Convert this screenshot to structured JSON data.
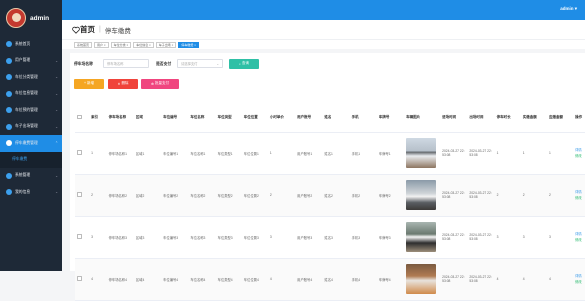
{
  "topbar": {
    "user": "admin ▾"
  },
  "brand": {
    "name": "admin"
  },
  "sidebar": {
    "items": [
      {
        "label": "系统首页",
        "arrow": ""
      },
      {
        "label": "用户管理",
        "arrow": "⌄"
      },
      {
        "label": "车位分类管理",
        "arrow": "⌄"
      },
      {
        "label": "车位信息管理",
        "arrow": "⌄"
      },
      {
        "label": "车位预约管理",
        "arrow": "⌄"
      },
      {
        "label": "车子出场管理",
        "arrow": "⌄"
      },
      {
        "label": "停车缴费管理",
        "arrow": "⌃"
      }
    ],
    "sub_item": "停车缴费",
    "items2": [
      {
        "label": "系统管理",
        "arrow": "⌄"
      },
      {
        "label": "我的信息",
        "arrow": "⌄"
      }
    ]
  },
  "header": {
    "home": "首页",
    "page": "停车缴费"
  },
  "tabs": [
    "系统首页",
    "用户 ×",
    "车位分类 ×",
    "车位信息 ×",
    "车子出场 ×",
    "停车缴费 ×"
  ],
  "filters": {
    "name_label": "停车场名称",
    "name_placeholder": "停车场名称",
    "paid_label": "是否支付",
    "paid_placeholder": "请选择支付",
    "search": "查询"
  },
  "actions": {
    "add": "+ 新增",
    "delete": "删除",
    "batch": "批量支付"
  },
  "table": {
    "headers": [
      "索引",
      "停车场名称",
      "区域",
      "车位编号",
      "车位名称",
      "车位类型",
      "车位位置",
      "小时单价",
      "用户账号",
      "姓名",
      "手机",
      "车牌号",
      "车辆图片",
      "进场时间",
      "出场时间",
      "停车时长",
      "实缴金额",
      "应缴金额",
      "操作"
    ],
    "rows": [
      {
        "idx": "1",
        "lot": "停车场名称1",
        "area": "区域1",
        "no": "车位编号1",
        "name": "车位名称1",
        "type": "车位类型1",
        "loc": "车位位置1",
        "price": "1",
        "acct": "用户账号1",
        "person": "姓名1",
        "phone": "手机1",
        "plate": "车牌号1",
        "in": "2024-03-27 22:53:08",
        "out": "2024-03-27 22:53:08",
        "dur": "1",
        "paid": "1",
        "due": "1",
        "op1": "详情",
        "op2": "修改"
      },
      {
        "idx": "2",
        "lot": "停车场名称2",
        "area": "区域2",
        "no": "车位编号2",
        "name": "车位名称2",
        "type": "车位类型2",
        "loc": "车位位置2",
        "price": "2",
        "acct": "用户账号2",
        "person": "姓名2",
        "phone": "手机2",
        "plate": "车牌号2",
        "in": "2024-03-27 22:53:08",
        "out": "2024-03-27 22:53:08",
        "dur": "2",
        "paid": "2",
        "due": "2",
        "op1": "详情",
        "op2": "修改"
      },
      {
        "idx": "3",
        "lot": "停车场名称3",
        "area": "区域3",
        "no": "车位编号3",
        "name": "车位名称3",
        "type": "车位类型3",
        "loc": "车位位置3",
        "price": "3",
        "acct": "用户账号3",
        "person": "姓名3",
        "phone": "手机3",
        "plate": "车牌号3",
        "in": "2024-03-27 22:53:08",
        "out": "2024-03-27 22:53:08",
        "dur": "3",
        "paid": "3",
        "due": "3",
        "op1": "详情",
        "op2": "修改"
      },
      {
        "idx": "4",
        "lot": "停车场名称4",
        "area": "区域4",
        "no": "车位编号4",
        "name": "车位名称4",
        "type": "车位类型4",
        "loc": "车位位置4",
        "price": "4",
        "acct": "用户账号4",
        "person": "姓名4",
        "phone": "手机4",
        "plate": "车牌号4",
        "in": "2024-03-27 22:53:08",
        "out": "2024-03-27 22:53:08",
        "dur": "4",
        "paid": "4",
        "due": "4",
        "op1": "详情",
        "op2": "修改"
      }
    ]
  },
  "colors": {
    "accent": "#1f8de6",
    "sidebar": "#1e2937",
    "add": "#f5a623",
    "delete": "#f0433a",
    "batch": "#f0457f",
    "search": "#2fc0a6"
  }
}
